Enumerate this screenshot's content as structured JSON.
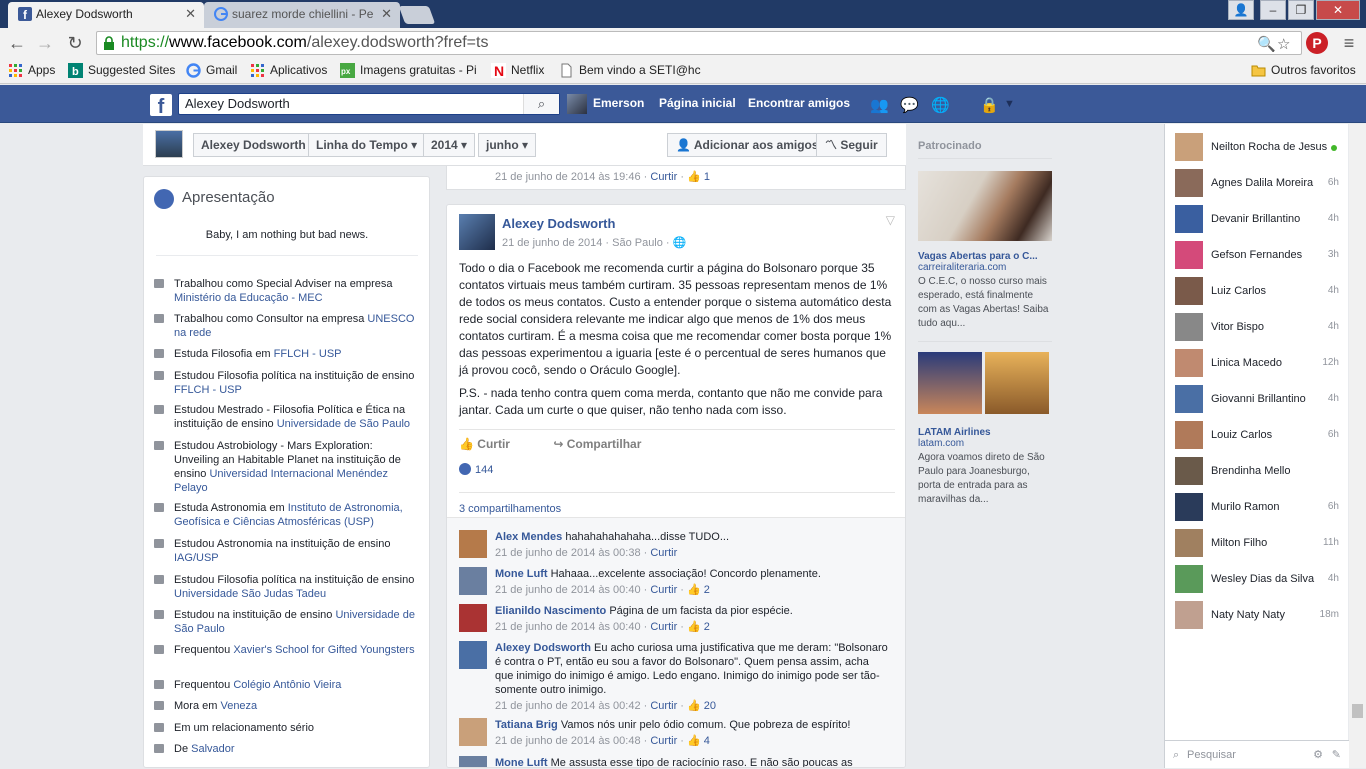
{
  "browser": {
    "tabs": [
      {
        "title": "Alexey Dodsworth",
        "active": true
      },
      {
        "title": "suarez morde chiellini - Pe",
        "active": false
      }
    ],
    "url_protocol": "https://",
    "url_host": "www.facebook.com",
    "url_path": "/alexey.dodsworth?fref=ts",
    "bookmarks": [
      {
        "label": "Apps",
        "icon": "apps-grid-icon"
      },
      {
        "label": "Suggested Sites",
        "icon": "bing-icon"
      },
      {
        "label": "Gmail",
        "icon": "google-icon"
      },
      {
        "label": "Aplicativos",
        "icon": "apps-grid-icon"
      },
      {
        "label": "Imagens gratuitas - Pi",
        "icon": "px-icon"
      },
      {
        "label": "Netflix",
        "icon": "netflix-icon"
      },
      {
        "label": "Bem vindo a SETI@hc",
        "icon": "page-icon"
      }
    ],
    "other_bookmarks": "Outros favoritos"
  },
  "fb": {
    "search_value": "Alexey Dodsworth",
    "user": "Emerson",
    "nav_home": "Página inicial",
    "nav_friends": "Encontrar amigos"
  },
  "timeline": {
    "name": "Alexey Dodsworth",
    "section": "Linha do Tempo",
    "year": "2014",
    "month": "junho",
    "add_friend": "Adicionar aos amigos",
    "follow": "Seguir"
  },
  "intro": {
    "title": "Apresentação",
    "bio": "Baby, I am nothing but bad news.",
    "items": [
      {
        "text": "Trabalhou como Special Adviser na empresa ",
        "link": "Ministério da Educação - MEC",
        "icon": "briefcase-icon"
      },
      {
        "text": "Trabalhou como Consultor na empresa ",
        "link": "UNESCO na rede",
        "icon": "briefcase-icon"
      },
      {
        "text": "Estuda Filosofia em ",
        "link": "FFLCH - USP",
        "icon": "graduation-icon"
      },
      {
        "text": "Estudou Filosofia política na instituição de ensino ",
        "link": "FFLCH - USP",
        "icon": "graduation-icon"
      },
      {
        "text": "Estudou Mestrado - Filosofia Política e Ética na instituição de ensino ",
        "link": "Universidade de São Paulo",
        "icon": "graduation-icon"
      },
      {
        "text": "Estudou Astrobiology - Mars Exploration: Unveiling an Habitable Planet na instituição de ensino ",
        "link": "Universidad Internacional Menéndez Pelayo",
        "icon": "graduation-icon"
      },
      {
        "text": "Estuda Astronomia em ",
        "link": "Instituto de Astronomia, Geofísica e Ciências Atmosféricas (USP)",
        "icon": "graduation-icon"
      },
      {
        "text": "Estudou Astronomia na instituição de ensino ",
        "link": "IAG/USP",
        "icon": "graduation-icon"
      },
      {
        "text": "Estudou Filosofia política na instituição de ensino ",
        "link": "Universidade São Judas Tadeu",
        "icon": "graduation-icon"
      },
      {
        "text": "Estudou na instituição de ensino ",
        "link": "Universidade de São Paulo",
        "icon": "graduation-icon"
      },
      {
        "text": "Frequentou ",
        "link": "Xavier's School for Gifted Youngsters",
        "icon": "graduation-icon"
      },
      {
        "text": "Frequentou ",
        "link": "Colégio Antônio Vieira",
        "icon": "graduation-icon"
      },
      {
        "text": "Mora em ",
        "link": "Veneza",
        "icon": "home-icon"
      },
      {
        "text": "Em um relacionamento sério",
        "link": "",
        "icon": "heart-icon"
      },
      {
        "text": "De ",
        "link": "Salvador",
        "icon": "location-pin-icon"
      }
    ]
  },
  "feed_top": {
    "date": "21 de junho de 2014 às 19:46",
    "like": "Curtir",
    "count": "1"
  },
  "post": {
    "author": "Alexey Dodsworth",
    "date": "21 de junho de 2014",
    "place": "São Paulo",
    "para1": "Todo o dia o Facebook me recomenda curtir a página do Bolsonaro porque 35 contatos virtuais meus também curtiram. 35 pessoas representam menos de 1% de todos os meus contatos. Custo a entender porque o sistema automático desta rede social considera relevante me indicar algo que menos de 1% dos meus contatos curtiram. É a mesma coisa que me recomendar comer bosta porque 1% das pessoas experimentou a iguaria [este é o percentual de seres humanos que já provou cocô, sendo o Oráculo Google].",
    "para2": "P.S. - nada tenho contra quem coma merda, contanto que não me convide para jantar. Cada um curte o que quiser, não tenho nada com isso.",
    "like_action": "Curtir",
    "share_action": "Compartilhar",
    "like_count": "144",
    "shares": "3 compartilhamentos",
    "comments": [
      {
        "name": "Alex Mendes",
        "text": "hahahahahahaha...disse TUDO...",
        "date": "21 de junho de 2014 às 00:38",
        "like": "Curtir",
        "likes": ""
      },
      {
        "name": "Mone Luft",
        "text": "Hahaaa...excelente associação! Concordo plenamente.",
        "date": "21 de junho de 2014 às 00:40",
        "like": "Curtir",
        "likes": "2"
      },
      {
        "name": "Elianildo Nascimento",
        "text": "Página de um facista da pior espécie.",
        "date": "21 de junho de 2014 às 00:40",
        "like": "Curtir",
        "likes": "2"
      },
      {
        "name": "Alexey Dodsworth",
        "text": "Eu acho curiosa uma justificativa que me deram: \"Bolsonaro é contra o PT, então eu sou a favor do Bolsonaro\". Quem pensa assim, acha que inimigo do inimigo é amigo. Ledo engano. Inimigo do inimigo pode ser tão-somente outro inimigo.",
        "date": "21 de junho de 2014 às 00:42",
        "like": "Curtir",
        "likes": "20"
      },
      {
        "name": "Tatiana Brig",
        "text": "Vamos nós unir pelo ódio comum. Que pobreza de espírito!",
        "date": "21 de junho de 2014 às 00:48",
        "like": "Curtir",
        "likes": "4"
      },
      {
        "name": "Mone Luft",
        "text": "Me assusta esse tipo de raciocínio raso. E não são poucas as pessoas",
        "date": "",
        "like": "",
        "likes": ""
      }
    ]
  },
  "ads": {
    "label": "Patrocinado",
    "ad1_title": "Vagas Abertas para o C...",
    "ad1_url": "carreiraliteraria.com",
    "ad1_text": "O C.E.C, o nosso curso mais esperado, está finalmente com as Vagas Abertas! Saiba tudo aqu...",
    "ad2_title": "LATAM Airlines",
    "ad2_url": "latam.com",
    "ad2_text": "Agora voamos direto de São Paulo para Joanesburgo, porta de entrada para as maravilhas da..."
  },
  "chat": {
    "friends": [
      {
        "name": "Neilton Rocha de Jesus",
        "time": "",
        "online": true
      },
      {
        "name": "Agnes Dalila Moreira",
        "time": "6h"
      },
      {
        "name": "Devanir Brillantino",
        "time": "4h"
      },
      {
        "name": "Gefson Fernandes",
        "time": "3h"
      },
      {
        "name": "Luiz Carlos",
        "time": "4h"
      },
      {
        "name": "Vitor Bispo",
        "time": "4h"
      },
      {
        "name": "Linica Macedo",
        "time": "12h"
      },
      {
        "name": "Giovanni Brillantino",
        "time": "4h"
      },
      {
        "name": "Louiz Carlos",
        "time": "6h"
      },
      {
        "name": "Brendinha Mello",
        "time": ""
      },
      {
        "name": "Murilo Ramon",
        "time": "6h"
      },
      {
        "name": "Milton Filho",
        "time": "11h"
      },
      {
        "name": "Wesley Dias da Silva",
        "time": "4h"
      },
      {
        "name": "Naty Naty Naty",
        "time": "18m"
      }
    ],
    "search_placeholder": "Pesquisar"
  },
  "colors": {
    "fb_blue": "#3b5998",
    "link": "#365899",
    "chrome_tabbar": "#213a66"
  }
}
